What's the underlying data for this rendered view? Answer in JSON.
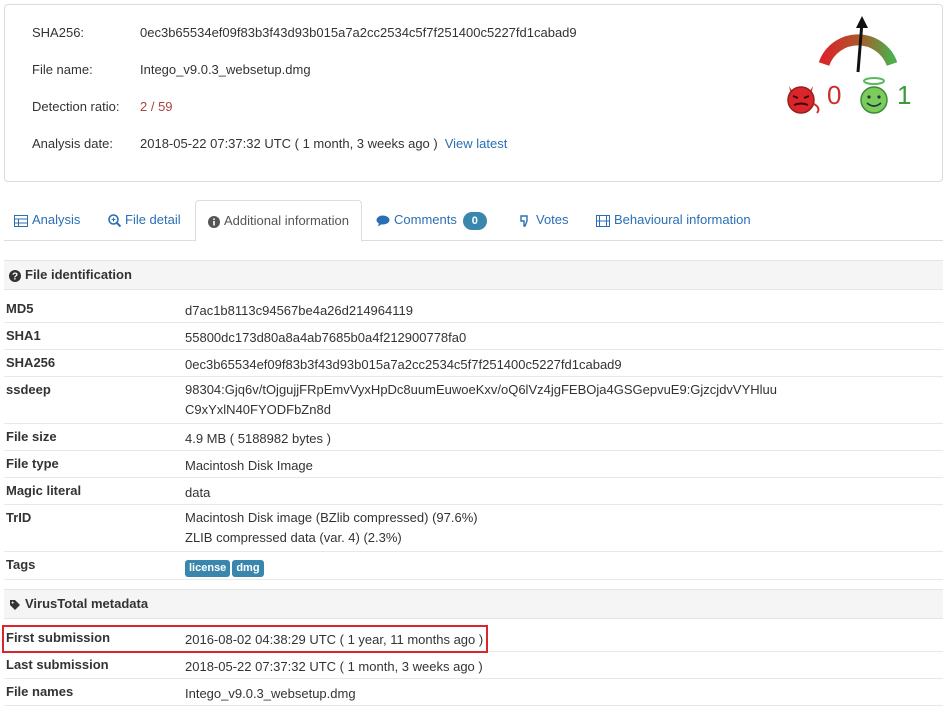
{
  "summary": {
    "sha256_label": "SHA256:",
    "sha256_value": "0ec3b65534ef09f83b3f43d93b015a7a2cc2534c5f7f251400c5227fd1cabad9",
    "filename_label": "File name:",
    "filename_value": "Intego_v9.0.3_websetup.dmg",
    "ratio_label": "Detection ratio:",
    "ratio_value": "2 / 59",
    "date_label": "Analysis date:",
    "date_value": "2018-05-22 07:37:32 UTC ( 1 month, 3 weeks ago )",
    "view_latest": "View latest"
  },
  "votes": {
    "bad_count": "0",
    "good_count": "1"
  },
  "tabs": [
    {
      "label": "Analysis",
      "icon": "table-icon"
    },
    {
      "label": "File detail",
      "icon": "search-plus-icon"
    },
    {
      "label": "Additional information",
      "icon": "info-circle-icon"
    },
    {
      "label": "Comments",
      "icon": "comment-icon",
      "badge": "0"
    },
    {
      "label": "Votes",
      "icon": "thumbs-icon"
    },
    {
      "label": "Behavioural information",
      "icon": "film-icon"
    }
  ],
  "file_identification": {
    "header": "File identification",
    "md5_label": "MD5",
    "md5_value": "d7ac1b8113c94567be4a26d214964119",
    "sha1_label": "SHA1",
    "sha1_value": "55800dc173d80a8a4ab7685b0a4f212900778fa0",
    "sha256_label": "SHA256",
    "sha256_value": "0ec3b65534ef09f83b3f43d93b015a7a2cc2534c5f7f251400c5227fd1cabad9",
    "ssdeep_label": "ssdeep",
    "ssdeep_line1": "98304:Gjq6v/tOjgujjFRpEmvVyxHpDc8uumEuwoeKxv/oQ6lVz4jgFEBOja4GSGepvuE9:GjzcjdvVYHluu",
    "ssdeep_line2": "C9xYxlN40FYODFbZn8d",
    "filesize_label": "File size",
    "filesize_value": "4.9 MB ( 5188982 bytes )",
    "filetype_label": "File type",
    "filetype_value": "Macintosh Disk Image",
    "magic_label": "Magic literal",
    "magic_value": "data",
    "trid_label": "TrID",
    "trid_line1": "Macintosh Disk image (BZlib compressed) (97.6%)",
    "trid_line2": "ZLIB compressed data (var. 4) (2.3%)",
    "tags_label": "Tags",
    "tags": [
      "license",
      "dmg"
    ]
  },
  "metadata": {
    "header": "VirusTotal metadata",
    "first_label": "First submission",
    "first_value": "2016-08-02 04:38:29 UTC ( 1 year, 11 months ago )",
    "last_label": "Last submission",
    "last_value": "2018-05-22 07:37:32 UTC ( 1 month, 3 weeks ago )",
    "names_label": "File names",
    "names_value": "Intego_v9.0.3_websetup.dmg"
  },
  "colors": {
    "link": "#2a6fb5",
    "ratio": "#a94442",
    "badge": "#3a87ad",
    "highlight": "#d9262c",
    "bad": "#c9302c",
    "good": "#3c9a3c"
  }
}
